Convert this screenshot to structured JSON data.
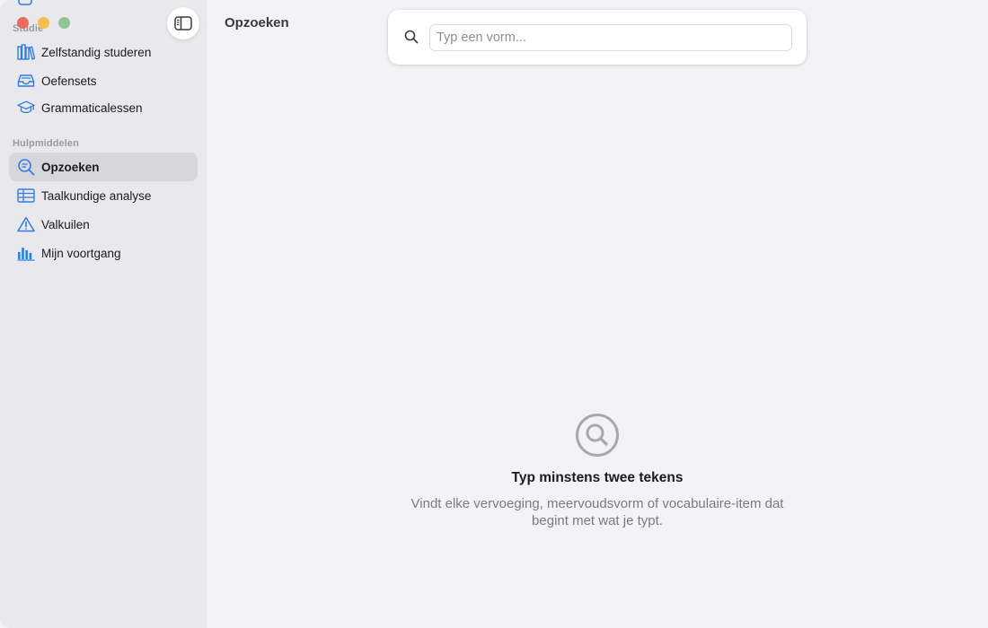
{
  "sidebar": {
    "sections": [
      {
        "label": "Studie",
        "items": [
          {
            "label": "Zelfstandig studeren",
            "icon": "books-icon"
          },
          {
            "label": "Oefensets",
            "icon": "tray-icon"
          },
          {
            "label": "Grammaticalessen",
            "icon": "graduation-cap-icon"
          }
        ]
      },
      {
        "label": "Hulpmiddelen",
        "items": [
          {
            "label": "Opzoeken",
            "icon": "magnifier-text-icon",
            "active": true
          },
          {
            "label": "Taalkundige analyse",
            "icon": "table-icon"
          },
          {
            "label": "Valkuilen",
            "icon": "warning-triangle-icon"
          },
          {
            "label": "Mijn voortgang",
            "icon": "bar-chart-icon"
          }
        ]
      }
    ]
  },
  "main": {
    "title": "Opzoeken",
    "search": {
      "placeholder": "Typ een vorm...",
      "value": ""
    },
    "empty_state": {
      "icon": "magnifier-circle-icon",
      "title": "Typ minstens twee tekens",
      "description": "Vindt elke vervoeging, meervoudsvorm of vocabulaire-item dat begint met wat je typt."
    }
  },
  "colors": {
    "accent": "#2f7de1",
    "sidebar_bg": "#e8e8ed",
    "main_bg": "#f2f2f7",
    "active_item_bg": "#d6d6db"
  }
}
